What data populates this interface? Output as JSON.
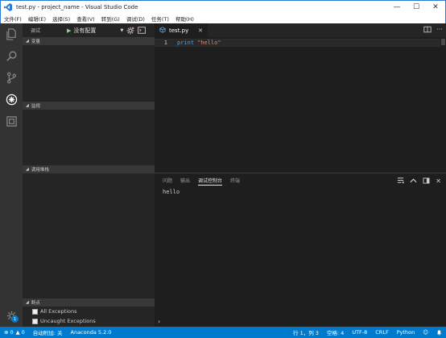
{
  "window": {
    "title": "test.py - project_name - Visual Studio Code",
    "controls": {
      "minimize": "—",
      "maximize": "☐",
      "close": "✕"
    }
  },
  "menu": [
    "文件(F)",
    "编辑(E)",
    "选择(S)",
    "查看(V)",
    "转到(G)",
    "调试(D)",
    "任务(T)",
    "帮助(H)"
  ],
  "activity_bar": {
    "icons": [
      "files-icon",
      "search-icon",
      "source-control-icon",
      "debug-icon",
      "extensions-icon"
    ],
    "active": "debug-icon",
    "settings_badge": "1"
  },
  "sidebar": {
    "debug_label": "调试",
    "config": "没有配置",
    "sections": {
      "variables": "变量",
      "watch": "监视",
      "call_stack": "调用堆栈",
      "breakpoints": "断点"
    },
    "breakpoints": [
      {
        "label": "All Exceptions"
      },
      {
        "label": "Uncaught Exceptions"
      }
    ]
  },
  "editor": {
    "tab": "test.py",
    "lines": [
      {
        "no": "1",
        "keyword": "print",
        "string": "\"hello\""
      }
    ]
  },
  "panel": {
    "tabs": [
      "问题",
      "输出",
      "调试控制台",
      "终端"
    ],
    "active_tab": "调试控制台",
    "output": "hello",
    "prompt": "›"
  },
  "statusbar": {
    "errors": "0",
    "warnings": "0",
    "auto_attach": "自动附加: 关",
    "interpreter": "Anaconda 5.2.0",
    "position": "行 1，列 3",
    "spaces": "空格: 4",
    "encoding": "UTF-8",
    "eol": "CRLF",
    "language": "Python"
  },
  "colors": {
    "status_bar": "#007acc",
    "activity_bar": "#333333",
    "sidebar": "#252526",
    "editor": "#1e1e1e",
    "keyword": "#569cd6",
    "string": "#ce9178"
  }
}
